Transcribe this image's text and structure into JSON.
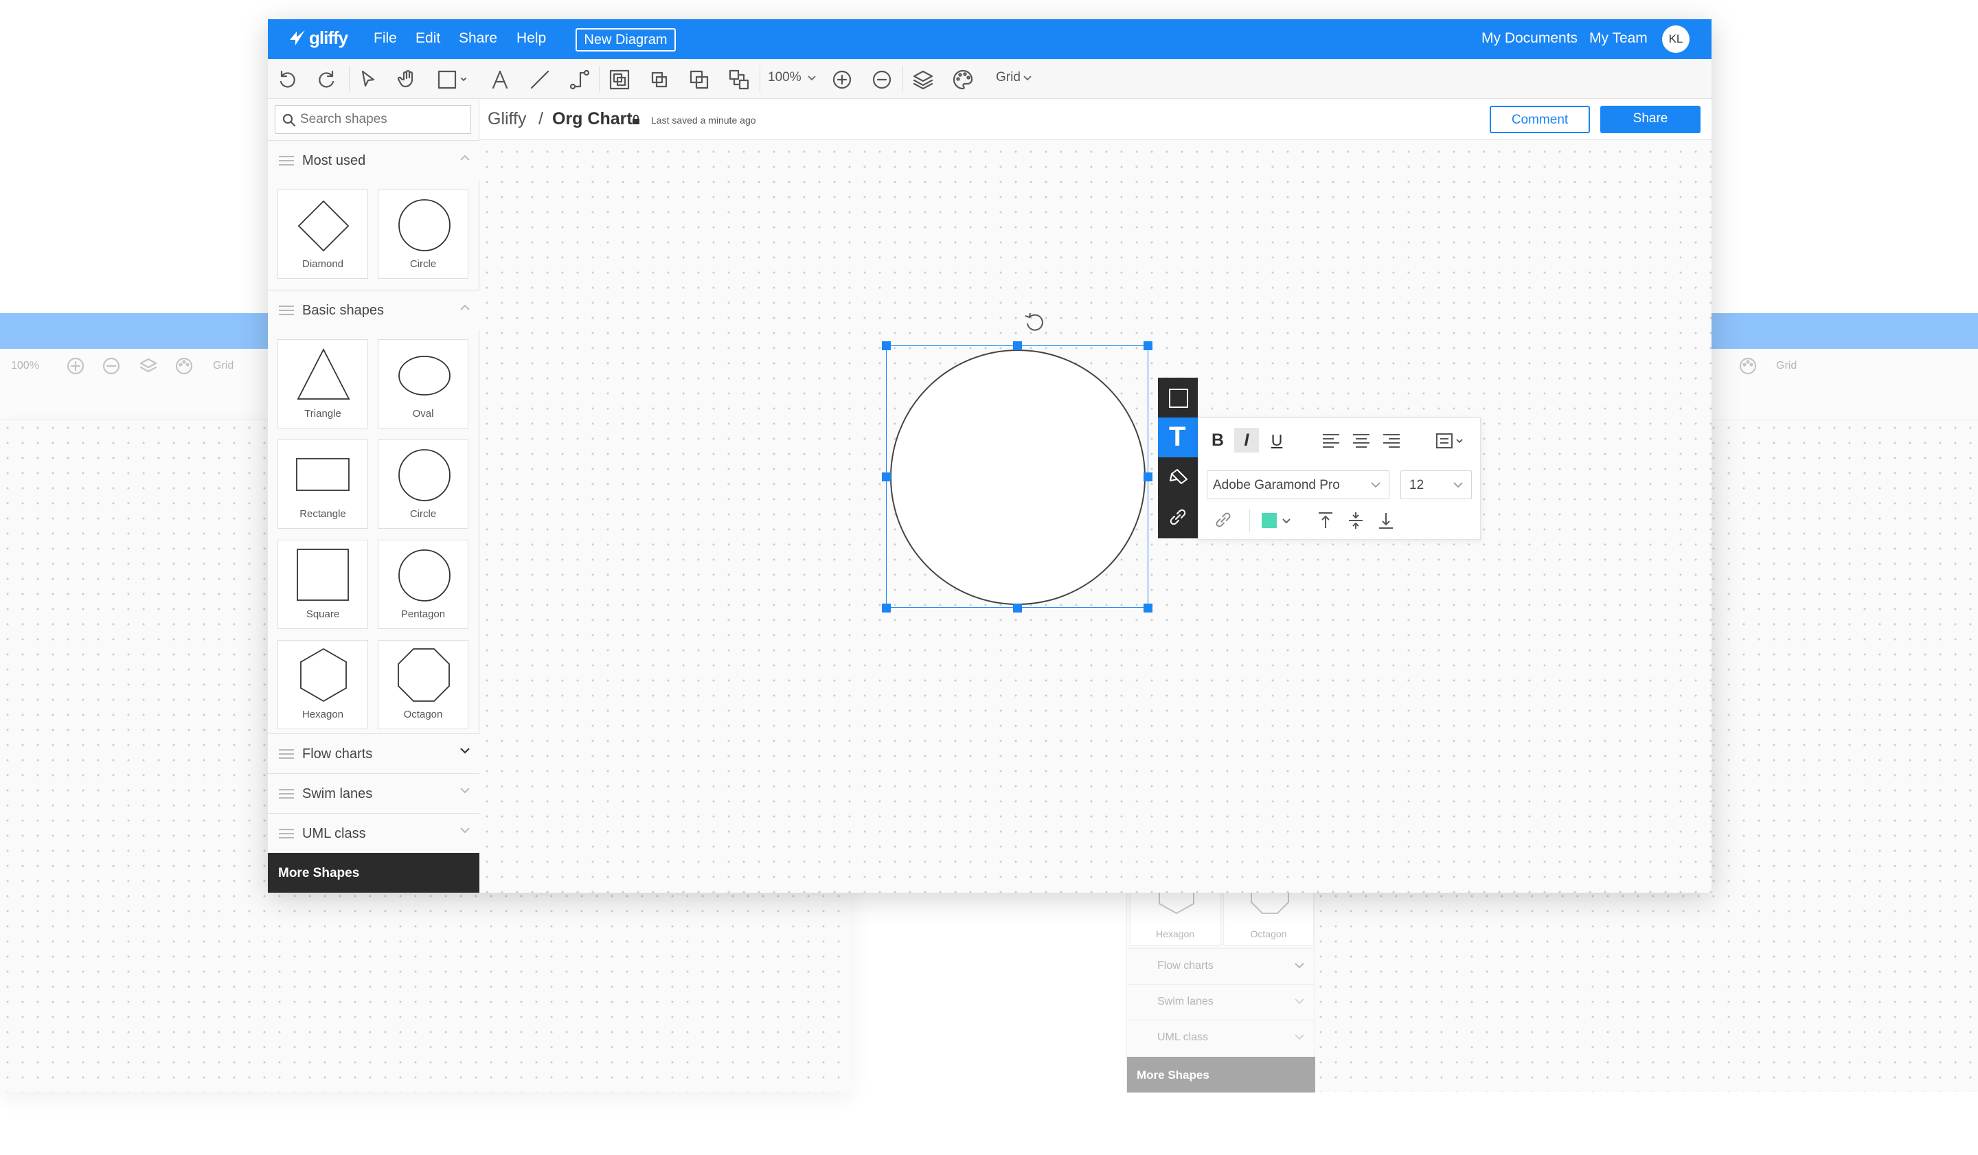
{
  "app": {
    "logo_text": "gliffy",
    "menu": [
      "File",
      "Edit",
      "Share",
      "Help"
    ],
    "new_diagram_label": "New Diagram",
    "right_links": [
      "My Documents",
      "My Team"
    ],
    "avatar_initials": "KL",
    "brand_color": "#1a85f5"
  },
  "toolbar": {
    "zoom": "100%",
    "grid_label": "Grid",
    "icons": [
      "undo-icon",
      "redo-icon",
      "pointer-icon",
      "hand-icon",
      "rectangle-icon",
      "text-icon",
      "line-icon",
      "connector-icon",
      "group-icon",
      "bring-forward-icon",
      "send-backward-icon",
      "arrange-icon",
      "zoom-in-icon",
      "zoom-out-icon",
      "layers-icon",
      "theme-icon"
    ]
  },
  "document": {
    "breadcrumb_root": "Gliffy",
    "separator": "/",
    "title": "Org Chart",
    "saved_status": "Last saved a minute ago",
    "comment_label": "Comment",
    "share_label": "Share"
  },
  "sidebar": {
    "search_placeholder": "Search shapes",
    "most_used": {
      "title": "Most used",
      "shapes": [
        "Diamond",
        "Circle"
      ]
    },
    "basic_shapes": {
      "title": "Basic shapes",
      "shapes": [
        "Triangle",
        "Oval",
        "Rectangle",
        "Circle",
        "Square",
        "Pentagon",
        "Hexagon",
        "Octagon"
      ]
    },
    "collapsed_sections": [
      "Flow charts",
      "Swim lanes",
      "UML class"
    ],
    "more_shapes_label": "More Shapes"
  },
  "text_panel": {
    "bold": "B",
    "italic": "I",
    "underline": "U",
    "font": "Adobe Garamond Pro",
    "size": "12",
    "text_color": "#4dd9b5",
    "active_tool": "T"
  },
  "ghost": {
    "zoom": "100%",
    "grid_label": "Grid",
    "shapes": [
      "Hexagon",
      "Octagon"
    ],
    "sections": [
      "Flow charts",
      "Swim lanes",
      "UML class"
    ],
    "more_shapes_label": "More Shapes"
  }
}
